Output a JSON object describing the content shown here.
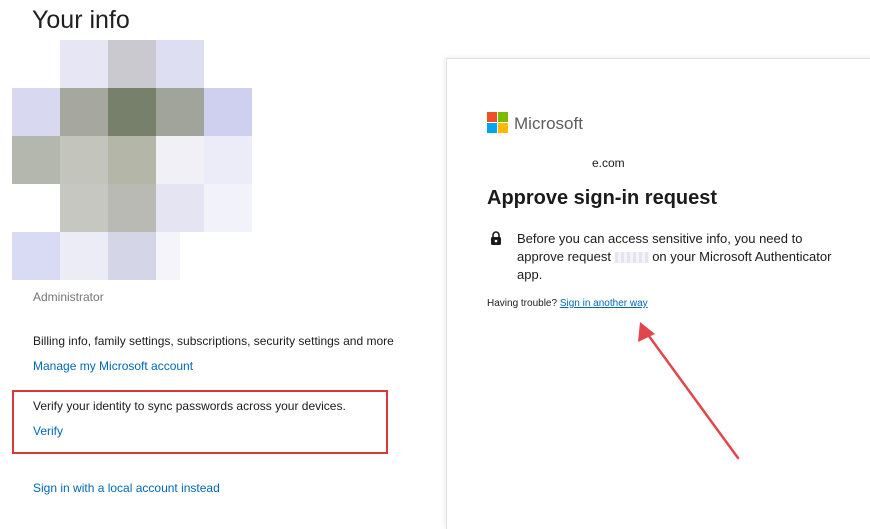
{
  "settings": {
    "title": "Your info",
    "role": "Administrator",
    "billing_text": "Billing info, family settings, subscriptions, security settings and more",
    "manage_link": "Manage my Microsoft account",
    "verify_text": "Verify your identity to sync passwords across your devices.",
    "verify_link": "Verify",
    "local_account_link": "Sign in with a local account instead"
  },
  "signin": {
    "brand": "Microsoft",
    "email_fragment": "e.com",
    "heading": "Approve sign-in request",
    "message_before": "Before you can access sensitive info, you need to approve request",
    "message_after": "on your Microsoft Authenticator app.",
    "trouble_label": "Having trouble?",
    "other_way_link": "Sign in another way"
  },
  "colors": {
    "link": "#0067b8",
    "highlight_border": "#d9363e",
    "arrow": "#e0474c",
    "ms_red": "#f25022",
    "ms_green": "#7fba00",
    "ms_blue": "#00a4ef",
    "ms_yellow": "#ffb900"
  }
}
